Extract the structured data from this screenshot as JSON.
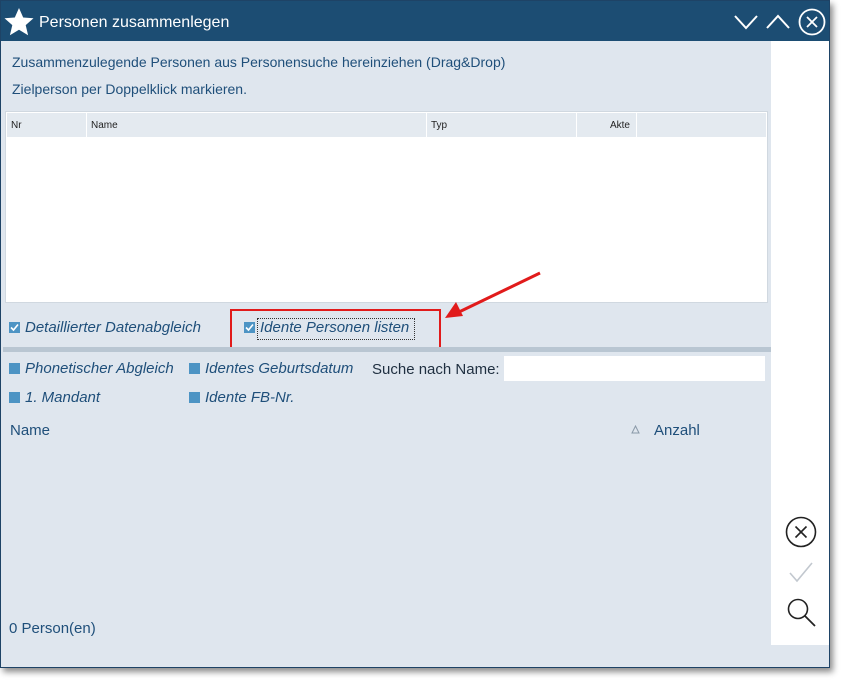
{
  "window": {
    "title": "Personen zusammenlegen"
  },
  "instructions": {
    "line1": "Zusammenzulegende Personen aus Personensuche hereinziehen (Drag&Drop)",
    "line2": "Zielperson per Doppelklick markieren."
  },
  "grid": {
    "columns": [
      "Nr",
      "Name",
      "Typ",
      "Akte"
    ],
    "rows": []
  },
  "options": {
    "detailed_compare": {
      "label": "Detaillierter Datenabgleich",
      "checked": true
    },
    "list_identical": {
      "label": "Idente Personen listen",
      "checked": true
    }
  },
  "filters": {
    "phonetic": {
      "label": "Phonetischer Abgleich",
      "checked": false
    },
    "birthdate": {
      "label": "Identes Geburtsdatum",
      "checked": false
    },
    "mandant": {
      "label": "1. Mandant",
      "checked": false
    },
    "fb_nr": {
      "label": "Idente FB-Nr.",
      "checked": false
    },
    "search_label": "Suche nach Name:",
    "search_value": ""
  },
  "results": {
    "col_name": "Name",
    "col_count": "Anzahl",
    "sort_icon": "sort-triangle-icon",
    "status": "0 Person(en)"
  },
  "icons": {
    "title": "star-icon",
    "minimize": "chevron-down-icon",
    "maximize": "chevron-up-icon",
    "close": "close-circle-icon",
    "cancel": "cancel-circle-icon",
    "confirm": "checkmark-icon",
    "search": "search-icon",
    "annotation": "red-arrow-icon"
  },
  "colors": {
    "titlebar": "#1c4d73",
    "background": "#dfe6ee",
    "checkbox": "#4d94c4",
    "text": "#1f4f7a",
    "annotation": "#e11b1b"
  }
}
